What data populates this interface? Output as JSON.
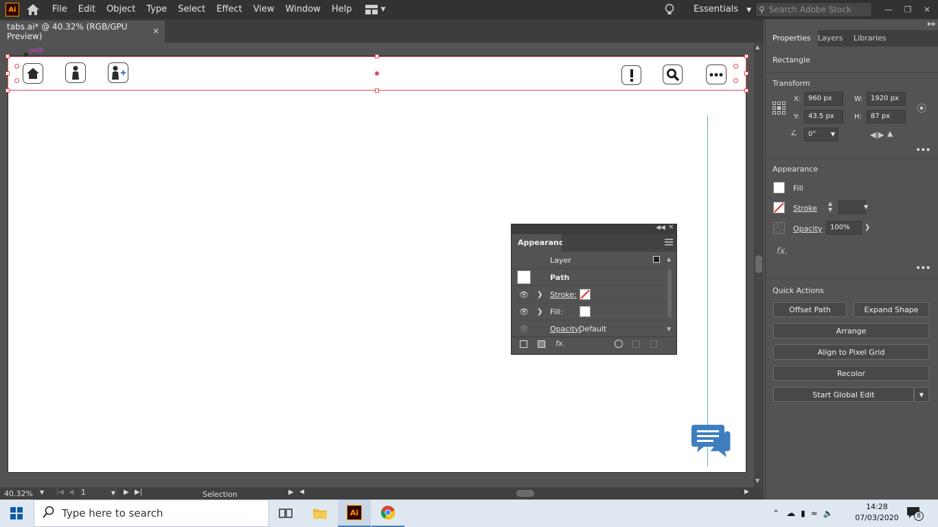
{
  "app": {
    "logo_text": "Ai"
  },
  "menu": [
    "File",
    "Edit",
    "Object",
    "Type",
    "Select",
    "Effect",
    "View",
    "Window",
    "Help"
  ],
  "workspace": {
    "label": "Essentials",
    "search_placeholder": "Search Adobe Stock"
  },
  "document": {
    "tab_title": "tabs.ai* @ 40.32% (RGB/GPU Preview)",
    "close_glyph": "×"
  },
  "canvas": {
    "smart_guide_label": "path"
  },
  "appearance_panel": {
    "title": "Appearance",
    "layer_label": "Layer",
    "path_label": "Path",
    "stroke_label": "Stroke:",
    "fill_label": "Fill:",
    "opacity_label": "Opacity:",
    "opacity_value": "Default"
  },
  "properties": {
    "tabs": [
      "Properties",
      "Layers",
      "Libraries"
    ],
    "object_type": "Rectangle",
    "transform": {
      "title": "Transform",
      "x_label": "X:",
      "x": "960 px",
      "y_label": "Y:",
      "y": "43.5 px",
      "w_label": "W:",
      "w": "1920 px",
      "h_label": "H:",
      "h": "87 px",
      "angle": "0°"
    },
    "appearance": {
      "title": "Appearance",
      "fill_label": "Fill",
      "stroke_label": "Stroke",
      "opacity_label": "Opacity",
      "opacity_value": "100%",
      "fx": "fx."
    },
    "quick_actions": {
      "title": "Quick Actions",
      "offset_path": "Offset Path",
      "expand_shape": "Expand Shape",
      "arrange": "Arrange",
      "align_pixel_grid": "Align to Pixel Grid",
      "recolor": "Recolor",
      "start_global_edit": "Start Global Edit"
    }
  },
  "status": {
    "zoom": "40.32%",
    "page": "1",
    "tool": "Selection"
  },
  "taskbar": {
    "search_placeholder": "Type here to search",
    "time": "14:28",
    "date": "07/03/2020",
    "notification_count": "8",
    "ai_label": "Ai"
  },
  "colors": {
    "selection": "#e0464f",
    "icon_blue": "#3f7fbf",
    "guide": "#5fb7a7",
    "magenta_label": "#d940d9"
  }
}
